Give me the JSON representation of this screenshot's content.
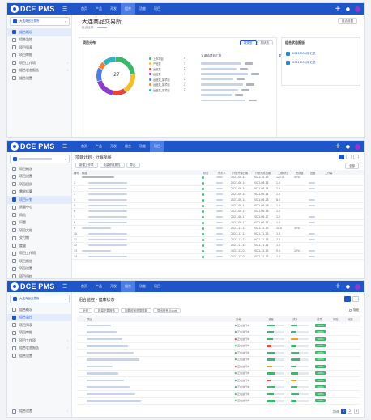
{
  "brand": "DCE PMS",
  "colors": {
    "brand_blue": "#1e55c8",
    "nav_active": "#4b7ee6",
    "green": "#3bb86b",
    "red": "#e0483b",
    "orange": "#f0a030",
    "purple": "#8b3cc9"
  },
  "screens": [
    {
      "nav": [
        "首页",
        "产品",
        "开发",
        "组合",
        "功能",
        "项目"
      ],
      "active_nav": 3,
      "project_name": "大连商品交易所",
      "sidebar": [
        {
          "label": "组合概况",
          "active": true
        },
        {
          "label": "组合监控",
          "active": false
        },
        {
          "label": "项目列表",
          "active": false
        },
        {
          "label": "项目审批",
          "active": false
        },
        {
          "label": "项目工作项",
          "active": false,
          "arrow": true
        },
        {
          "label": "组合状态报告",
          "active": false,
          "arrow": true
        },
        {
          "label": "组合设置",
          "active": false
        }
      ],
      "page_title": "大连商品交易所",
      "page_subtitle": "组合经理：",
      "page_button": "组合设置",
      "panel_distribution_title": "项目分布",
      "tabs": [
        "按类型",
        "按状态"
      ],
      "donut_center": "27",
      "legend": [
        {
          "label": "上市项目",
          "value": "4",
          "color": "#3bb86b"
        },
        {
          "label": "产品类",
          "value": "3",
          "color": "#f0c030"
        },
        {
          "label": "运维类",
          "value": "2",
          "color": "#e0483b"
        },
        {
          "label": "运营类",
          "value": "3",
          "color": "#8b3cc9"
        },
        {
          "label": "运营类_新项目",
          "value": "2",
          "color": "#4b7ee6"
        },
        {
          "label": "运营类_新项目",
          "value": "1",
          "color": "#f08030"
        },
        {
          "label": "运营类_新项目",
          "value": "2",
          "color": "#30b0c0"
        }
      ],
      "list_title": "1_组合项目汇报",
      "list_more": "更多",
      "panel_right_title": "组合状态报告",
      "reports": [
        {
          "label": "2021年04月 汇总"
        },
        {
          "label": "2021年03月 汇总"
        }
      ]
    },
    {
      "nav": [
        "首页",
        "产品",
        "开发",
        "组合",
        "功能",
        "项目"
      ],
      "active_nav": 5,
      "page_title": "项目计划 · 分解视图",
      "toolbar": [
        "新建工作项",
        "批量修改属性",
        "导出"
      ],
      "view_label": "全部",
      "sidebar": [
        {
          "label": "项目概况"
        },
        {
          "label": "项目设置"
        },
        {
          "label": "项目团队"
        },
        {
          "label": "需求估算"
        },
        {
          "label": "项目计划",
          "active": true
        },
        {
          "label": "质量中心"
        },
        {
          "label": "风险"
        },
        {
          "label": "问题"
        },
        {
          "label": "项目文档"
        },
        {
          "label": "交付物"
        },
        {
          "label": "度量"
        },
        {
          "label": "项目工作项"
        },
        {
          "label": "项目报告"
        },
        {
          "label": "项目设置"
        },
        {
          "label": "项目归档"
        },
        {
          "label": "基线"
        }
      ],
      "columns": [
        "编号",
        "标题",
        "状态",
        "负责人",
        "计划开始日期",
        "计划完成日期",
        "工期(天)",
        "完成度",
        "进度",
        "工作量"
      ],
      "rows": [
        {
          "id": "",
          "start": "2021-06-14",
          "end": "2021-10-13",
          "dur": "122.0",
          "pct": "40%"
        },
        {
          "id": "1",
          "start": "2021-06-14",
          "end": "2021-06-14",
          "dur": "1.0",
          "pct": ""
        },
        {
          "id": "2",
          "start": "2021-06-14",
          "end": "2021-06-14",
          "dur": "1.0",
          "pct": ""
        },
        {
          "id": "3",
          "start": "2021-06-14",
          "end": "2021-06-14",
          "dur": "1.0",
          "pct": ""
        },
        {
          "id": "4",
          "start": "2021-06-14",
          "end": "2021-06-28",
          "dur": "8.0",
          "pct": ""
        },
        {
          "id": "5",
          "start": "2021-06-14",
          "end": "2021-06-28",
          "dur": "1.0",
          "pct": ""
        },
        {
          "id": "6",
          "start": "2021-06-15",
          "end": "2021-06-16",
          "dur": "1.0",
          "pct": ""
        },
        {
          "id": "7",
          "start": "2021-06-17",
          "end": "2021-06-17",
          "dur": "1.0",
          "pct": ""
        },
        {
          "id": "8",
          "start": "2021-06-17",
          "end": "2021-06-27",
          "dur": "1.0",
          "pct": ""
        },
        {
          "id": "9",
          "start": "2021-11-12",
          "end": "2021-12-13",
          "dur": "10.0",
          "pct": "40%"
        },
        {
          "id": "10",
          "start": "2021-11-12",
          "end": "2021-11-13",
          "dur": "1.0",
          "pct": ""
        },
        {
          "id": "11",
          "start": "2021-11-12",
          "end": "2021-11-15",
          "dur": "2.0",
          "pct": ""
        },
        {
          "id": "12",
          "start": "2021-11-15",
          "end": "2021-11-15",
          "dur": "1.0",
          "pct": ""
        },
        {
          "id": "13",
          "start": "2021-12-01",
          "end": "2021-12-13",
          "dur": "5.0",
          "pct": "20%"
        },
        {
          "id": "14",
          "start": "2021-12-01",
          "end": "2021-12-13",
          "dur": "1.0",
          "pct": ""
        }
      ]
    },
    {
      "nav": [
        "首页",
        "产品",
        "开发",
        "组合",
        "功能",
        "项目"
      ],
      "active_nav": 3,
      "project_name": "大连商品交易所",
      "sidebar": [
        {
          "label": "组合概况"
        },
        {
          "label": "组合监控",
          "active": true
        },
        {
          "label": "项目列表"
        },
        {
          "label": "项目审批"
        },
        {
          "label": "项目工作项",
          "arrow": true
        },
        {
          "label": "组合状态报告",
          "arrow": true
        },
        {
          "label": "组合设置"
        }
      ],
      "page_title": "组合监控 · 健康状态",
      "filter_checkbox": "隐藏",
      "toolbar": [
        "全部",
        "批量下载报告",
        "加载时间范围更新",
        "导出所有 Excel"
      ],
      "columns": [
        "项目",
        "阶段",
        "进度",
        "成本",
        "质量",
        "风险",
        "问题"
      ],
      "bottom_left": "组合设置",
      "pagination": [
        "共8条",
        "1",
        "2",
        "3"
      ],
      "rows": [
        {
          "status_color": "#3bb86b",
          "stage": "正在进行中",
          "p": 0.5,
          "pc": "#3bb86b",
          "c": 0.35,
          "cc": "#3bb86b",
          "q": "100%"
        },
        {
          "status_color": "#3bb86b",
          "stage": "正在进行中",
          "p": 0.4,
          "pc": "#3bb86b",
          "c": 0.3,
          "cc": "#3bb86b",
          "q": "100%"
        },
        {
          "status_color": "#e0483b",
          "stage": "正在进行中",
          "p": 0.35,
          "pc": "#3bb86b",
          "c": 0.4,
          "cc": "#f0a030",
          "q": "100%"
        },
        {
          "status_color": "#3bb86b",
          "stage": "正在进行中",
          "p": 0.25,
          "pc": "#e0483b",
          "c": 0.3,
          "cc": "#3bb86b",
          "q": "100%"
        },
        {
          "status_color": "#3bb86b",
          "stage": "正在进行中",
          "p": 0.5,
          "pc": "#3bb86b",
          "c": 0.45,
          "cc": "#3bb86b",
          "q": "100%"
        },
        {
          "status_color": "#3bb86b",
          "stage": "正在进行中",
          "p": 0.45,
          "pc": "#3bb86b",
          "c": 0.5,
          "cc": "#3bb86b",
          "q": "100%"
        },
        {
          "status_color": "#e0483b",
          "stage": "正在进行中",
          "p": 0.3,
          "pc": "#f0a030",
          "c": 0.25,
          "cc": "#3bb86b",
          "q": "100%"
        },
        {
          "status_color": "#3bb86b",
          "stage": "正在进行中",
          "p": 0.5,
          "pc": "#3bb86b",
          "c": 0.4,
          "cc": "#3bb86b",
          "q": "100%"
        },
        {
          "status_color": "#3bb86b",
          "stage": "正在进行中",
          "p": 0.2,
          "pc": "#e0483b",
          "c": 0.3,
          "cc": "#f0a030",
          "q": "100%"
        },
        {
          "status_color": "#3bb86b",
          "stage": "正在进行中",
          "p": 0.45,
          "pc": "#3bb86b",
          "c": 0.35,
          "cc": "#3bb86b",
          "q": "100%"
        },
        {
          "status_color": "#3bb86b",
          "stage": "正在进行中",
          "p": 0.4,
          "pc": "#3bb86b",
          "c": 0.45,
          "cc": "#3bb86b",
          "q": "100%"
        },
        {
          "status_color": "#3bb86b",
          "stage": "正在进行中",
          "p": 0.5,
          "pc": "#3bb86b",
          "c": 0.3,
          "cc": "#3bb86b",
          "q": "100%"
        }
      ]
    }
  ]
}
